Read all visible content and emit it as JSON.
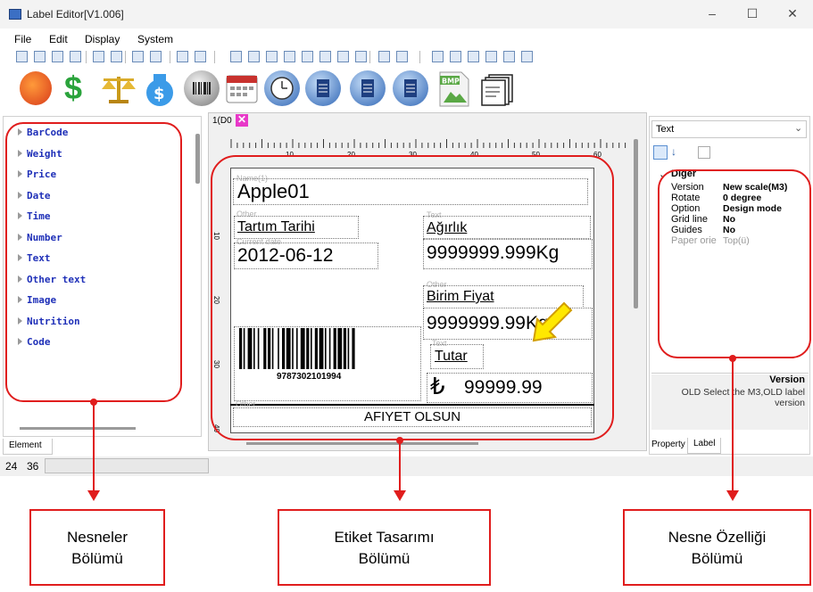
{
  "window": {
    "title": "Label Editor[V1.006]"
  },
  "menu": [
    "File",
    "Edit",
    "Display",
    "System"
  ],
  "elements_panel": {
    "items": [
      "BarCode",
      "Weight",
      "Price",
      "Date",
      "Time",
      "Number",
      "Text",
      "Other text",
      "Image",
      "Nutrition",
      "Code"
    ],
    "tab_label": "Element"
  },
  "status": {
    "x": "24",
    "y": "36"
  },
  "canvas": {
    "tab_label": "1(D0",
    "ruler_marks": [
      "10",
      "20",
      "30",
      "40",
      "50",
      "60"
    ],
    "vruler_marks": [
      "10",
      "20",
      "30",
      "40"
    ],
    "fields": {
      "name_ghost": "Name(1)",
      "name_value": "Apple01",
      "other_ghost": "Other",
      "tartim_label": "Tartım Tarihi",
      "date_ghost": "Current date",
      "date_value": "2012-06-12",
      "text_ghost1": "Text",
      "agirlik_label": "Ağırlık",
      "weight_value": "9999999.999Kg",
      "other_ghost2": "Other",
      "birim_label": "Birim Fiyat",
      "unit_price_value": "9999999.99Kg",
      "text_ghost2": "Text",
      "tutar_label": "Tutar",
      "lira_symbol": "₺",
      "total_value": "99999.99",
      "barcode_number": "9787302101994",
      "footer_ghost": "Other",
      "footer_text": "AFIYET OLSUN"
    }
  },
  "properties_panel": {
    "dropdown_value": "Text",
    "group_title": "Diğer",
    "rows": [
      {
        "name": "Version",
        "value": "New scale(M3)"
      },
      {
        "name": "Rotate",
        "value": "0 degree"
      },
      {
        "name": "Option",
        "value": "Design mode"
      },
      {
        "name": "Grid line",
        "value": "No"
      },
      {
        "name": "Guides",
        "value": "No"
      },
      {
        "name": "Paper orie",
        "value": "Top(ü)"
      }
    ],
    "desc_title": "Version",
    "desc_text": "OLD Select the M3,OLD label version",
    "tabs": [
      "Property",
      "Label"
    ]
  },
  "callouts": {
    "left": "Nesneler Bölümü",
    "center": "Etiket Tasarımı Bölümü",
    "right": "Nesne Özelliği Bölümü"
  },
  "colors": {
    "accent_red": "#e01d1d",
    "tree_blue": "#1f30b8",
    "arrow_yellow": "#ffe800"
  }
}
